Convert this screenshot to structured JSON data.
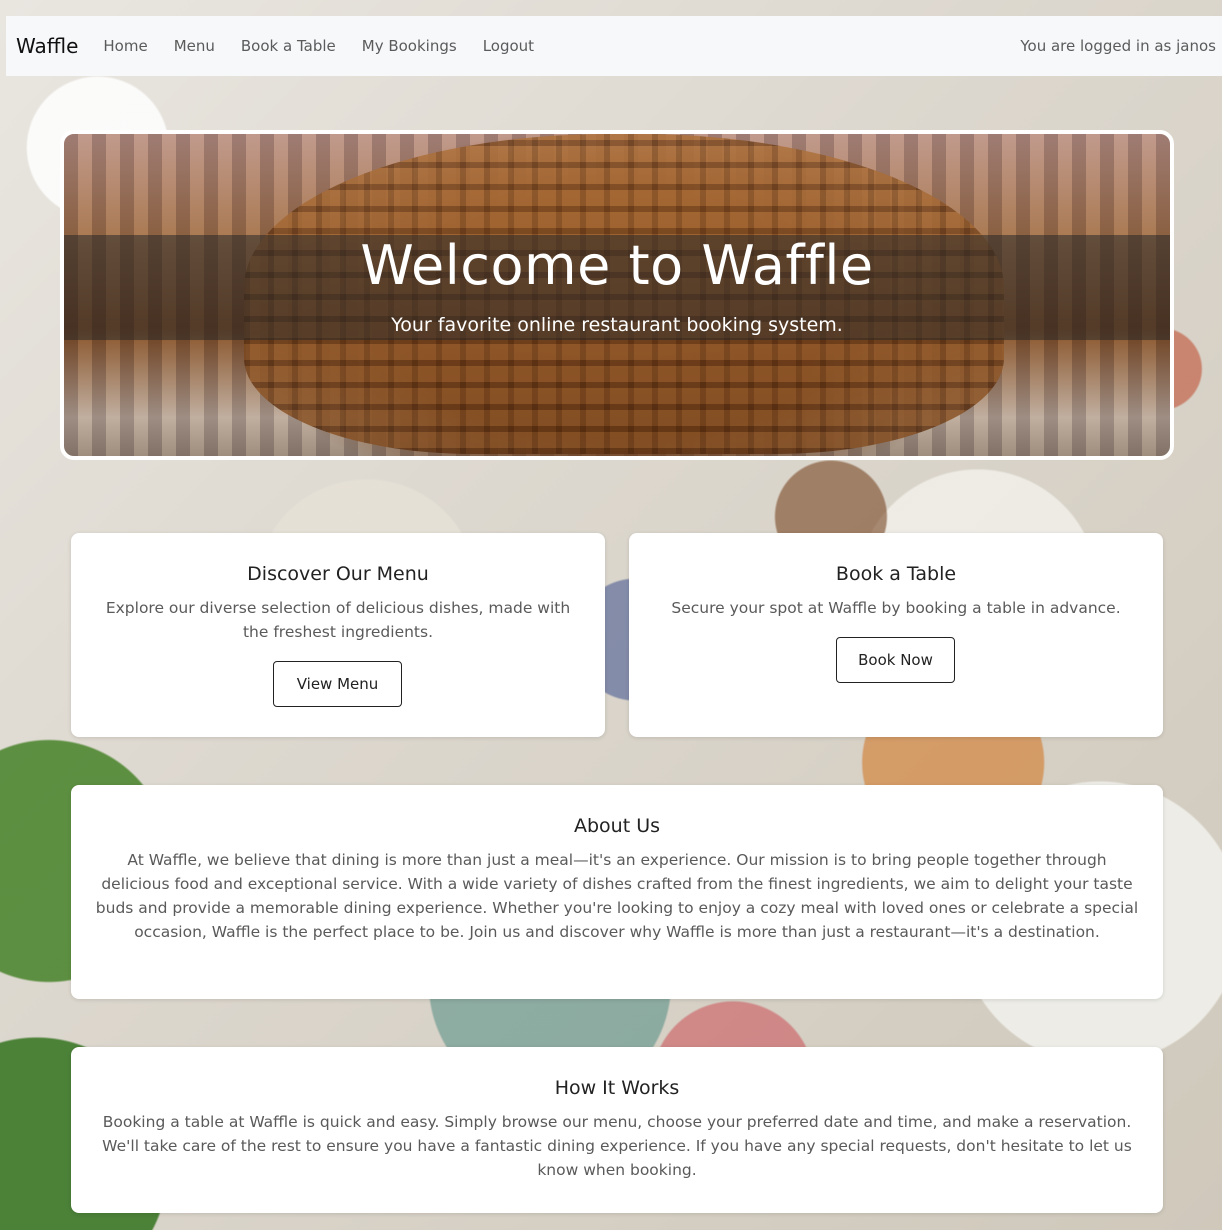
{
  "navbar": {
    "brand": "Waffle",
    "links": [
      "Home",
      "Menu",
      "Book a Table",
      "My Bookings",
      "Logout"
    ],
    "user_text": "You are logged in as janos"
  },
  "hero": {
    "title": "Welcome to Waffle",
    "subtitle": "Your favorite online restaurant booking system."
  },
  "cards": {
    "menu": {
      "title": "Discover Our Menu",
      "text": "Explore our diverse selection of delicious dishes, made with the freshest ingredients.",
      "button": "View Menu"
    },
    "book": {
      "title": "Book a Table",
      "text": "Secure your spot at Waffle by booking a table in advance.",
      "button": "Book Now"
    },
    "about": {
      "title": "About Us",
      "text": "At Waffle, we believe that dining is more than just a meal—it's an experience. Our mission is to bring people together through delicious food and exceptional service. With a wide variety of dishes crafted from the finest ingredients, we aim to delight your taste buds and provide a memorable dining experience. Whether you're looking to enjoy a cozy meal with loved ones or celebrate a special occasion, Waffle is the perfect place to be. Join us and discover why Waffle is more than just a restaurant—it's a destination."
    },
    "how": {
      "title": "How It Works",
      "text": "Booking a table at Waffle is quick and easy. Simply browse our menu, choose your preferred date and time, and make a reservation. We'll take care of the rest to ensure you have a fantastic dining experience. If you have any special requests, don't hesitate to let us know when booking."
    }
  }
}
